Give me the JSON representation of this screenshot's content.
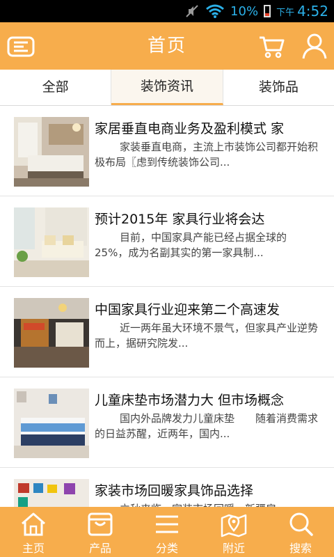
{
  "status_bar": {
    "battery_percent": "10%",
    "ampm": "下午",
    "time": "4:52"
  },
  "header": {
    "title": "首页"
  },
  "tabs": [
    {
      "label": "全部",
      "active": false
    },
    {
      "label": "装饰资讯",
      "active": true
    },
    {
      "label": "装饰品",
      "active": false
    }
  ],
  "news": [
    {
      "title": "家居垂直电商业务及盈利模式 家",
      "summary": "家装垂直电商，主流上市装饰公司都开始积极布局〖虑到传统装饰公司..."
    },
    {
      "title": "预计2015年 家具行业将会达",
      "summary": "目前，中国家具产能已经占据全球的25%，成为名副其实的第一家具制..."
    },
    {
      "title": "中国家具行业迎来第二个高速发",
      "summary": "近一两年虽大环境不景气，但家具产业逆势而上，据研究院发..."
    },
    {
      "title": "儿童床垫市场潜力大 但市场概念",
      "summary": "国内外品牌发力儿童床垫　　随着消费需求的日益苏醒，近两年，国内..."
    },
    {
      "title": "家装市场回暖家具饰品选择",
      "summary": "立秋来临，家装市场回暖，新疆房..."
    }
  ],
  "bottom_nav": [
    {
      "label": "主页",
      "icon": "home-icon"
    },
    {
      "label": "产品",
      "icon": "product-box-icon"
    },
    {
      "label": "分类",
      "icon": "category-icon"
    },
    {
      "label": "附近",
      "icon": "map-icon"
    },
    {
      "label": "搜索",
      "icon": "search-icon"
    }
  ],
  "colors": {
    "accent": "#f7ad4c",
    "status_text": "#2bb0e8"
  }
}
